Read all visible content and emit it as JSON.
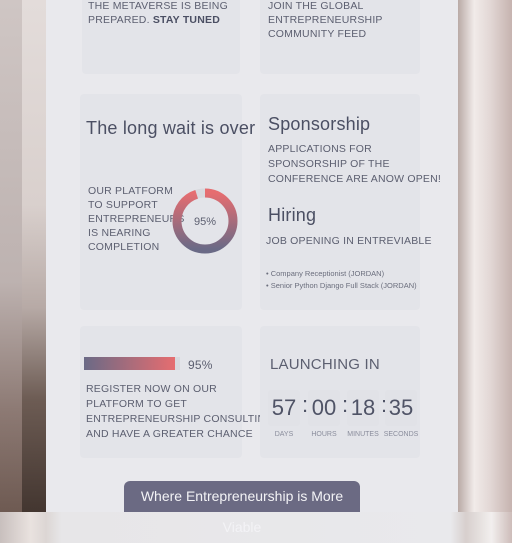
{
  "top": {
    "left_line1": "THE METAVERSE IS BEING",
    "left_line2a": "PREPARED. ",
    "left_line2b": "STAY TUNED",
    "right_line1": "JOIN THE GLOBAL",
    "right_line2": "ENTREPRENEURSHIP",
    "right_line3": "COMMUNITY FEED"
  },
  "wait": {
    "title": "The long wait is over",
    "desc": [
      "OUR PLATFORM",
      "TO SUPPORT",
      "ENTREPRENEURS",
      "IS NEARING",
      "COMPLETION"
    ],
    "progress_label": "95%",
    "progress_value": 0.95
  },
  "sponsorship": {
    "title": "Sponsorship",
    "desc": [
      "APPLICATIONS FOR",
      "SPONSORSHIP OF THE",
      "CONFERENCE ARE ANOW OPEN!"
    ]
  },
  "hiring": {
    "title": "Hiring",
    "subtitle": "JOB OPENING IN ENTREVIABLE",
    "jobs": [
      "Company Receptionist (JORDAN)",
      "Senior Python Django Full Stack (JORDAN)"
    ]
  },
  "register": {
    "progress_label": "95%",
    "progress_value": 0.95,
    "desc": [
      "REGISTER NOW ON OUR",
      "PLATFORM TO GET",
      "ENTREPRENEURSHIP CONSULTING",
      "AND HAVE A GREATER CHANCE"
    ]
  },
  "launch": {
    "title": "LAUNCHING IN",
    "days": "57",
    "hours": "00",
    "minutes": "18",
    "seconds": "35",
    "days_label": "DAYS",
    "hours_label": "HOURS",
    "minutes_label": "MINUTES",
    "seconds_label": "SECONDS",
    "colon": ":"
  },
  "cta": {
    "label": "Where Entrepreneurship is More Viable"
  },
  "colors": {
    "accent_start": "#6a6a86",
    "accent_end": "#e66d70",
    "cta_bg": "#6b6a83"
  }
}
